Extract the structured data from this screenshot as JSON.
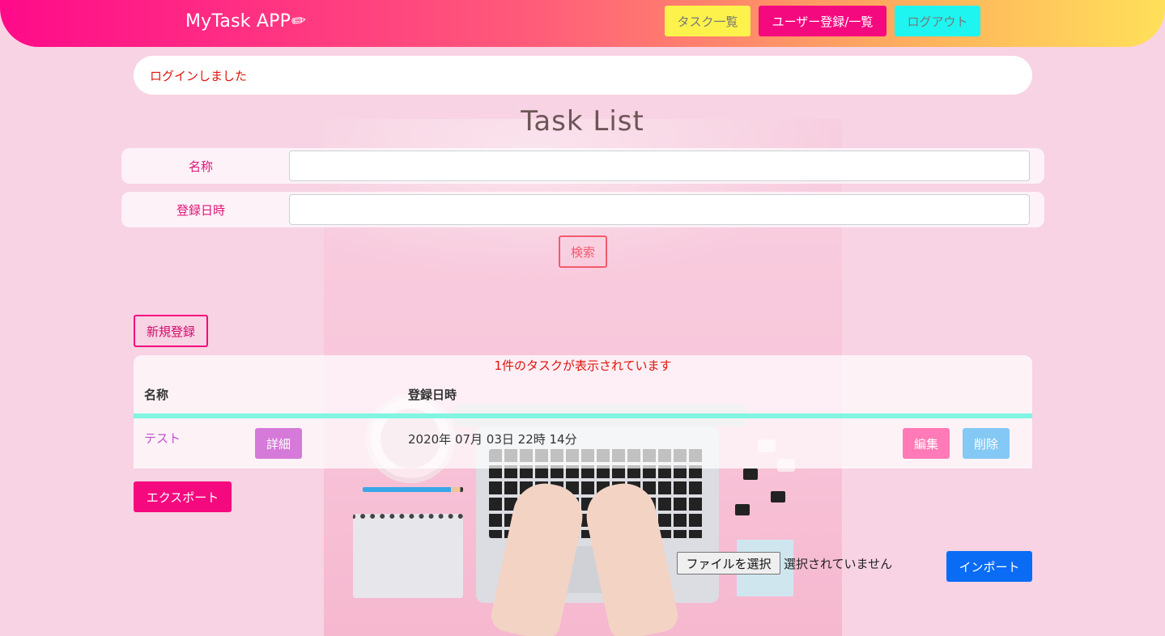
{
  "header": {
    "brand": "MyTask APP",
    "brand_icon": "✏",
    "nav": {
      "tasks": "タスク一覧",
      "users": "ユーザー登録/一覧",
      "logout": "ログアウト"
    }
  },
  "flash": "ログインしました",
  "page_title": "Task List",
  "search": {
    "name_label": "名称",
    "name_value": "",
    "date_label": "登録日時",
    "date_value": "",
    "submit": "検索"
  },
  "list": {
    "new_button": "新規登録",
    "count_message": "1件のタスクが表示されています",
    "columns": [
      "名称",
      "登録日時"
    ],
    "rows": [
      {
        "name": "テスト",
        "detail": "詳細",
        "created_at": "2020年 07月 03日 22時 14分",
        "edit": "編集",
        "delete": "削除"
      }
    ],
    "export_button": "エクスポート"
  },
  "import": {
    "file_button": "ファイルを選択",
    "file_status": "選択されていません",
    "import_button": "インポート"
  },
  "colors": {
    "background": "#f7d3e3",
    "accent": "#f5097f",
    "nav_tasks": "#fdf24c",
    "nav_logout": "#1ff5f0",
    "import": "#0a6cf5",
    "flash_text": "#e0140c"
  }
}
